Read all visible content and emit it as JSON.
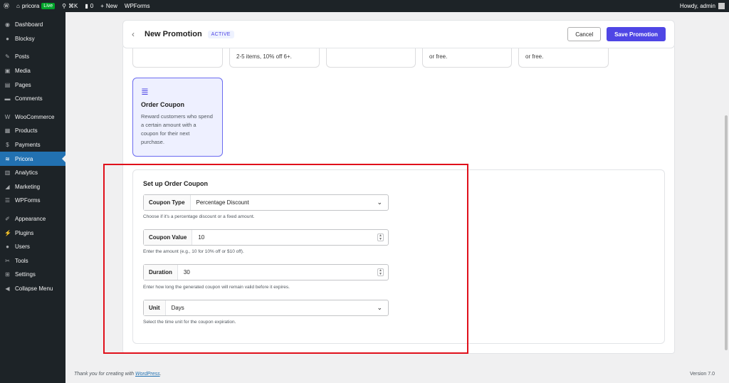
{
  "adminbar": {
    "site_name": "pricora",
    "live_badge": "Live",
    "shortcut": "⌘K",
    "comments_count": "0",
    "new_label": "New",
    "wpforms_label": "WPForms",
    "howdy": "Howdy, admin"
  },
  "sidebar": {
    "items": [
      {
        "label": "Dashboard",
        "icon": "dashboard-icon"
      },
      {
        "label": "Blocksy",
        "icon": "blocksy-icon"
      },
      {
        "label": "Posts",
        "icon": "pin-icon"
      },
      {
        "label": "Media",
        "icon": "media-icon"
      },
      {
        "label": "Pages",
        "icon": "page-icon"
      },
      {
        "label": "Comments",
        "icon": "comment-icon"
      },
      {
        "label": "WooCommerce",
        "icon": "woo-icon"
      },
      {
        "label": "Products",
        "icon": "box-icon"
      },
      {
        "label": "Payments",
        "icon": "payment-icon"
      },
      {
        "label": "Pricora",
        "icon": "pricora-icon"
      },
      {
        "label": "Analytics",
        "icon": "chart-icon"
      },
      {
        "label": "Marketing",
        "icon": "megaphone-icon"
      },
      {
        "label": "WPForms",
        "icon": "form-icon"
      },
      {
        "label": "Appearance",
        "icon": "brush-icon"
      },
      {
        "label": "Plugins",
        "icon": "plug-icon"
      },
      {
        "label": "Users",
        "icon": "user-icon"
      },
      {
        "label": "Tools",
        "icon": "wrench-icon"
      },
      {
        "label": "Settings",
        "icon": "settings-icon"
      },
      {
        "label": "Collapse Menu",
        "icon": "collapse-icon"
      }
    ]
  },
  "header": {
    "title": "New Promotion",
    "status": "ACTIVE",
    "cancel_label": "Cancel",
    "save_label": "Save Promotion"
  },
  "type_cards": {
    "card2_text": "2-5 items, 10% off 6+.",
    "card4_text": "or free.",
    "card5_text": "or free."
  },
  "selected_card": {
    "title": "Order Coupon",
    "description": "Reward customers who spend a certain amount with a coupon for their next purchase."
  },
  "setup": {
    "title": "Set up Order Coupon",
    "coupon_type": {
      "label": "Coupon Type",
      "value": "Percentage Discount",
      "help": "Choose if it's a percentage discount or a fixed amount."
    },
    "coupon_value": {
      "label": "Coupon Value",
      "value": "10",
      "help": "Enter the amount (e.g., 10 for 10% off or $10 off)."
    },
    "duration": {
      "label": "Duration",
      "value": "30",
      "help": "Enter how long the generated coupon will remain valid before it expires."
    },
    "unit": {
      "label": "Unit",
      "value": "Days",
      "help": "Select the time unit for the coupon expiration."
    }
  },
  "footer": {
    "text": "Thank you for creating with ",
    "link": "WordPress",
    "period": ".",
    "version": "Version 7.0"
  },
  "colors": {
    "accent": "#4f46e5",
    "admin_bar": "#1d2327",
    "active_menu": "#2271b1",
    "highlight_box": "#e0101b"
  }
}
